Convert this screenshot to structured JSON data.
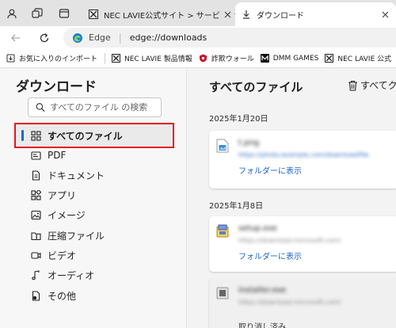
{
  "tabs": [
    {
      "title": "NEC LAVIE公式サイト > サービス&サ",
      "active": false
    },
    {
      "title": "ダウンロード",
      "active": true
    }
  ],
  "address": {
    "brand": "Edge",
    "url": "edge://downloads"
  },
  "bookmarks": [
    {
      "label": "お気に入りのインポート",
      "icon": "import-icon"
    },
    {
      "label": "NEC LAVIE 製品情報",
      "icon": "nec-logo-icon"
    },
    {
      "label": "詐欺ウォール",
      "icon": "shield-icon"
    },
    {
      "label": "DMM GAMES",
      "icon": "dmm-logo-icon"
    },
    {
      "label": "NEC LAVIE 公式",
      "icon": "nec-logo-icon"
    }
  ],
  "sidebar": {
    "title": "ダウンロード",
    "search_placeholder": "すべてのファイル の検索",
    "categories": [
      {
        "label": "すべてのファイル",
        "icon": "grid-icon"
      },
      {
        "label": "PDF",
        "icon": "pdf-icon"
      },
      {
        "label": "ドキュメント",
        "icon": "document-icon"
      },
      {
        "label": "アプリ",
        "icon": "apps-icon"
      },
      {
        "label": "イメージ",
        "icon": "image-icon"
      },
      {
        "label": "圧縮ファイル",
        "icon": "zip-folder-icon"
      },
      {
        "label": "ビデオ",
        "icon": "video-icon"
      },
      {
        "label": "オーディオ",
        "icon": "audio-icon"
      },
      {
        "label": "その他",
        "icon": "other-icon"
      }
    ]
  },
  "main": {
    "title": "すべてのファイル",
    "clear_all": "すべてク",
    "groups": [
      {
        "date": "2025年1月20日",
        "items": [
          {
            "name": "t.png",
            "url": "https://photo.example.com/download/file",
            "action": "フォルダーに表示"
          }
        ]
      },
      {
        "date": "2025年1月8日",
        "items": [
          {
            "name": "setup.exe",
            "url": "https://download.microsoft.com/",
            "action": "フォルダーに表示"
          },
          {
            "name": "installer.exe",
            "url": "https://download.microsoft.com/",
            "status": "取り消し済み"
          }
        ]
      }
    ]
  },
  "colors": {
    "accent": "#0f6cbd",
    "highlight_border": "#e8131f",
    "link": "#1a63c7"
  }
}
